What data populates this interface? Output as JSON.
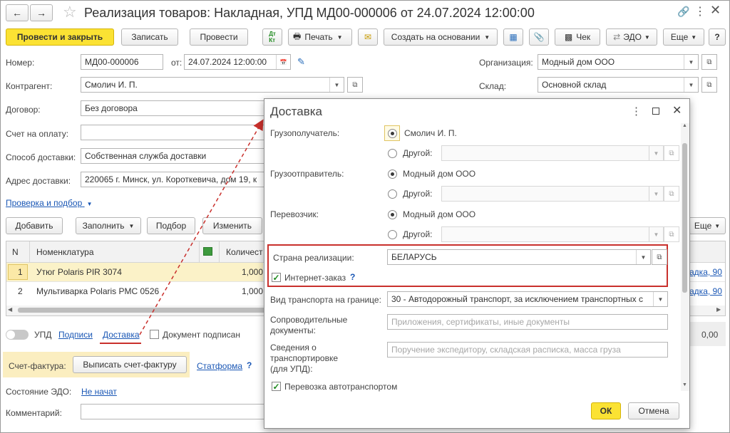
{
  "window": {
    "title": "Реализация товаров: Накладная, УПД МД00-000006 от 24.07.2024 12:00:00"
  },
  "toolbar": {
    "post_close": "Провести и закрыть",
    "save": "Записать",
    "post": "Провести",
    "print": "Печать",
    "create_based": "Создать на основании",
    "receipt": "Чек",
    "edo": "ЭДО",
    "more": "Еще"
  },
  "header": {
    "number_label": "Номер:",
    "number_value": "МД00-000006",
    "from_label": "от:",
    "date_value": "24.07.2024 12:00:00",
    "org_label": "Организация:",
    "org_value": "Модный дом ООО",
    "counterparty_label": "Контрагент:",
    "counterparty_value": "Смолич И. П.",
    "warehouse_label": "Склад:",
    "warehouse_value": "Основной склад",
    "contract_label": "Договор:",
    "contract_value": "Без договора",
    "invoice_label": "Счет на оплату:",
    "invoice_value": "",
    "delivery_method_label": "Способ доставки:",
    "delivery_method_value": "Собственная служба доставки",
    "delivery_address_label": "Адрес доставки:",
    "delivery_address_value": "220065 г. Минск, ул. Короткевича, дом 19, к",
    "check_link": "Проверка и подбор"
  },
  "table_toolbar": {
    "add": "Добавить",
    "fill": "Заполнить",
    "pick": "Подбор",
    "change": "Изменить",
    "more": "Еще"
  },
  "table": {
    "col_n": "N",
    "col_nomenclature": "Номенклатура",
    "col_qty": "Количест",
    "rows": [
      {
        "n": "1",
        "name": "Утюг Polaris PIR 3074",
        "qty": "1,000",
        "right": "адка, 90"
      },
      {
        "n": "2",
        "name": "Мультиварка Polaris PMC 0526",
        "qty": "1,000",
        "right": "адка, 90"
      }
    ]
  },
  "footer": {
    "upd_label": "УПД",
    "signatures_link": "Подписи",
    "delivery_link": "Доставка",
    "doc_signed_label": "Документ подписан",
    "total_value": "0,00",
    "invoice_label": "Счет-фактура:",
    "issue_invoice": "Выписать счет-фактуру",
    "statforma_link": "Статформа",
    "help": "?",
    "edo_state_label": "Состояние ЭДО:",
    "edo_state_link": "Не начат",
    "comment_label": "Комментарий:"
  },
  "dialog": {
    "title": "Доставка",
    "consignee_label": "Грузополучатель:",
    "consignee_value": "Смолич И. П.",
    "other_label": "Другой:",
    "shipper_label": "Грузоотправитель:",
    "shipper_value": "Модный дом ООО",
    "carrier_label": "Перевозчик:",
    "carrier_value": "Модный дом ООО",
    "country_label": "Страна реализации:",
    "country_value": "БЕЛАРУСЬ",
    "internet_order_label": "Интернет-заказ",
    "help": "?",
    "transport_label": "Вид транспорта на границе:",
    "transport_value": "30 - Автодорожный транспорт, за исключением транспортных с",
    "accompanying_label_1": "Сопроводительные",
    "accompanying_label_2": "документы:",
    "accompanying_placeholder": "Приложения, сертификаты, иные документы",
    "transport_info_label_1": "Сведения о",
    "transport_info_label_2": "транспортировке",
    "transport_info_label_3": "(для УПД):",
    "transport_info_placeholder": "Поручение экспедитору, складская расписка, масса груза",
    "auto_transport_label": "Перевозка автотранспортом",
    "ok": "ОК",
    "cancel": "Отмена"
  },
  "colors": {
    "accent_yellow": "#fbe233",
    "link_blue": "#1a57b5",
    "highlight_red": "#c9302c",
    "row_selected": "#fbf2c8"
  }
}
